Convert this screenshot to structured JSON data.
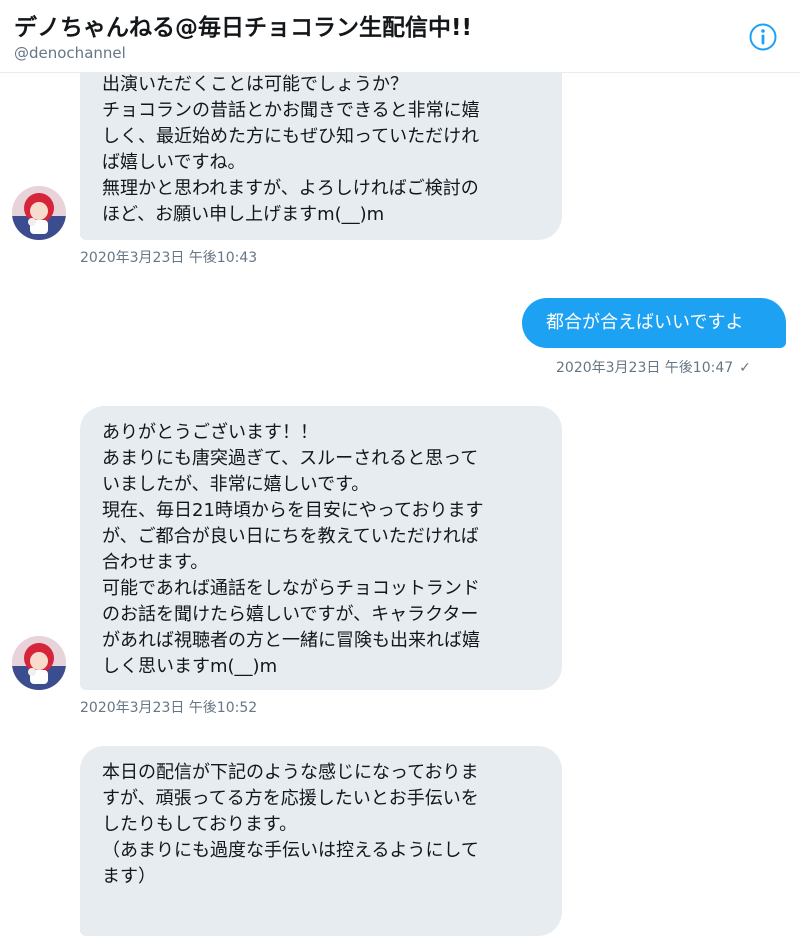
{
  "header": {
    "title": "デノちゃんねる@毎日チョコラン生配信中!!",
    "handle": "@denochannel"
  },
  "messages": [
    {
      "lines": [
        "出演いただくことは可能でしょうか？",
        "チョコランの昔話とかお聞きできると非常に嬉",
        "しく、最近始めた方にもぜひ知っていただけれ",
        "ば嬉しいですね。",
        "無理かと思われますが、よろしければご検討の",
        "ほど、お願い申し上げますm(__)m"
      ],
      "timestamp": "2020年3月23日 午後10:43"
    },
    {
      "text": "都合が合えばいいですよ",
      "timestamp": "2020年3月23日 午後10:47",
      "read_mark": "✓"
    },
    {
      "lines": [
        "ありがとうございます！！",
        "あまりにも唐突過ぎて、スルーされると思って",
        "いましたが、非常に嬉しいです。",
        "現在、毎日21時頃からを目安にやっております",
        "が、ご都合が良い日にちを教えていただければ",
        "合わせます。",
        "可能であれば通話をしながらチョコットランド",
        "のお話を聞けたら嬉しいですが、キャラクター",
        "があれば視聴者の方と一緒に冒険も出来れば嬉",
        "しく思いますm(__)m"
      ],
      "timestamp": "2020年3月23日 午後10:52"
    },
    {
      "lines": [
        "本日の配信が下記のような感じになっておりま",
        "すが、頑張ってる方を応援したいとお手伝いを",
        "したりもしております。",
        "（あまりにも過度な手伝いは控えるようにして",
        "ます）"
      ]
    }
  ],
  "colors": {
    "incoming_bubble": "#e6ecf0",
    "outgoing_bubble": "#1da1f2",
    "timestamp": "#657786",
    "accent": "#1da1f2"
  },
  "icons": [
    "info-icon",
    "avatar",
    "read-check-icon"
  ]
}
